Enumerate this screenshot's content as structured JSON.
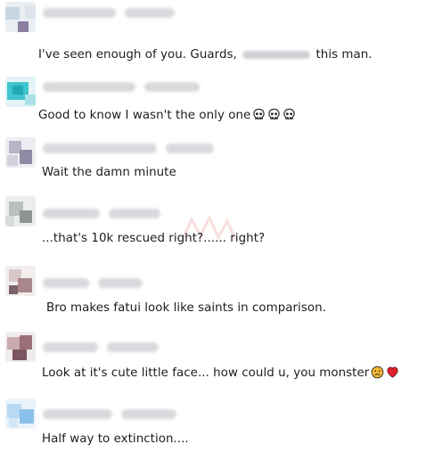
{
  "comments": [
    {
      "text_before": "I've seen enough of you. Guards,",
      "text_after": "this man."
    },
    {
      "text": "Good to know I wasn't the only one",
      "emoji": [
        "skull",
        "skull",
        "skull"
      ]
    },
    {
      "text": "Wait the damn minute"
    },
    {
      "text": "...that's 10k rescued right?...... right?"
    },
    {
      "text": "Bro makes fatui look like saints in comparison."
    },
    {
      "text": "Look at it's cute little face... how could u, you monster",
      "emoji": [
        "frowning-face",
        "red-heart"
      ]
    },
    {
      "text": "Half way to extinction...."
    }
  ]
}
